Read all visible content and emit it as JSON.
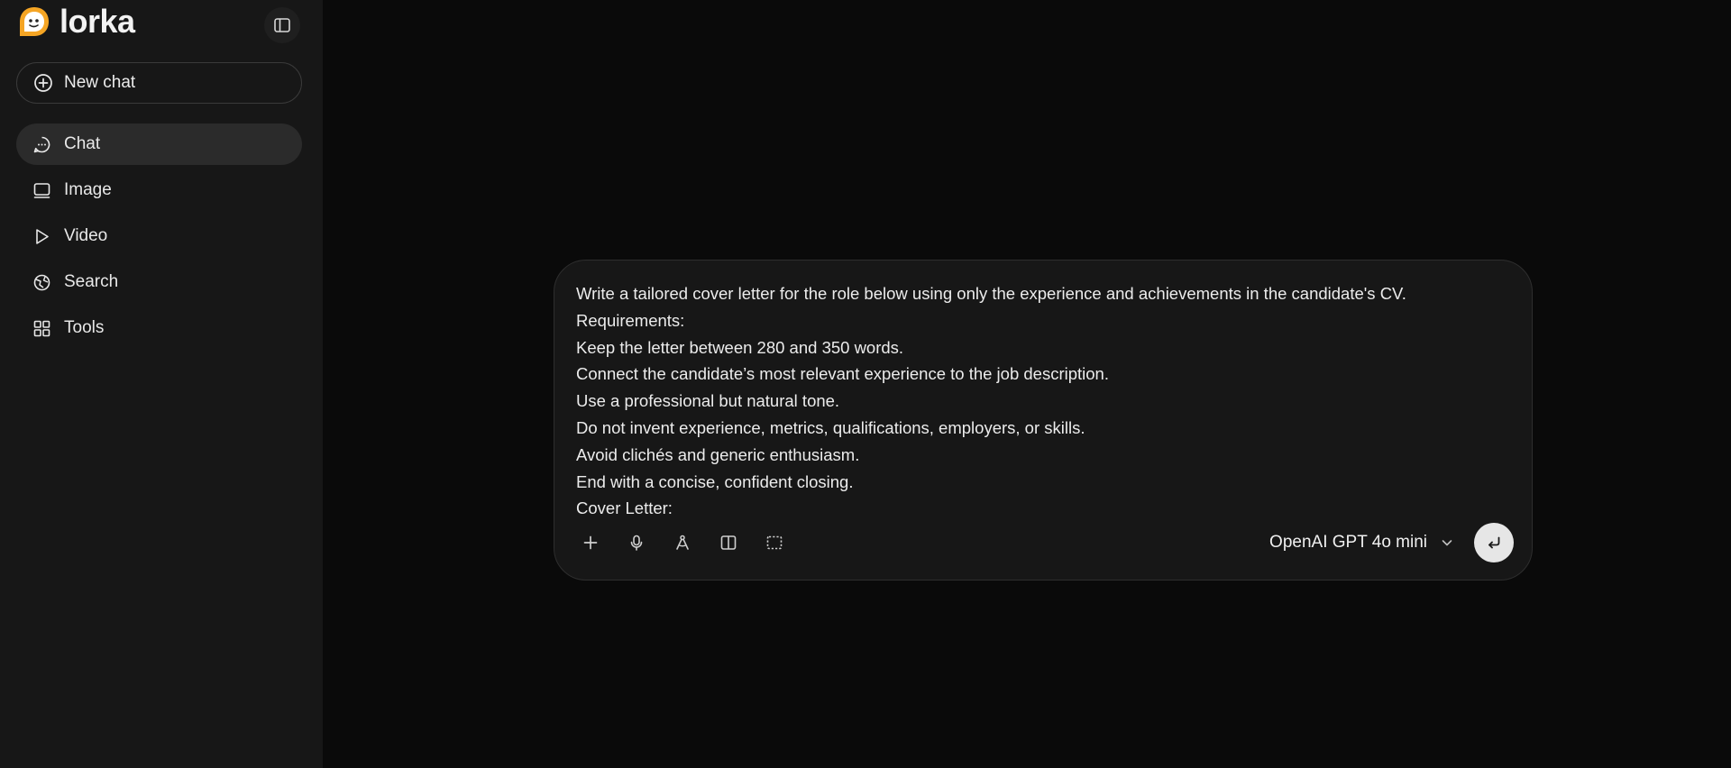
{
  "brand": {
    "name": "lorka",
    "accent": "#f5a524"
  },
  "sidebar": {
    "new_chat_label": "New chat",
    "items": [
      {
        "label": "Chat",
        "icon": "chat-bubble-icon",
        "active": true
      },
      {
        "label": "Image",
        "icon": "image-frame-icon",
        "active": false
      },
      {
        "label": "Video",
        "icon": "play-icon",
        "active": false
      },
      {
        "label": "Search",
        "icon": "globe-icon",
        "active": false
      },
      {
        "label": "Tools",
        "icon": "grid-icon",
        "active": false
      }
    ]
  },
  "composer": {
    "prompt_lines": [
      "Write a tailored cover letter for the role below using only the experience and achievements in the candidate's CV.",
      "Requirements:",
      "Keep the letter between 280 and 350 words.",
      "Connect the candidate’s most relevant experience to the job description.",
      "Use a professional but natural tone.",
      "Do not invent experience, metrics, qualifications, employers, or skills.",
      "Avoid clichés and generic enthusiasm.",
      "End with a concise, confident closing.",
      "Cover Letter:"
    ],
    "model_label": "OpenAI GPT 4o mini",
    "tools": [
      "plus-icon",
      "microphone-icon",
      "compass-icon",
      "split-view-icon",
      "select-area-icon"
    ]
  }
}
